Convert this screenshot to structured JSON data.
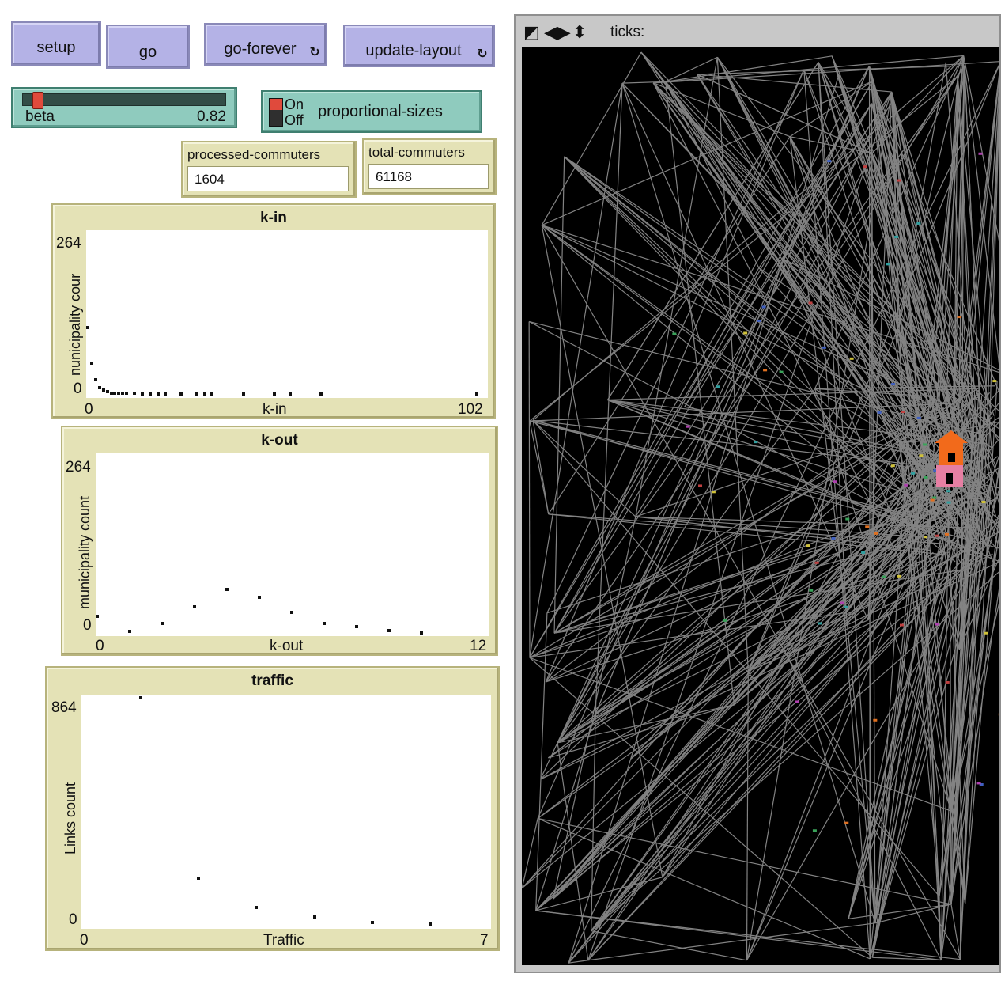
{
  "buttons": {
    "setup": "setup",
    "go": "go",
    "go_forever": "go-forever",
    "update_layout": "update-layout"
  },
  "slider": {
    "name": "beta",
    "value": "0.82",
    "level": 0.82
  },
  "switch": {
    "on_label": "On",
    "off_label": "Off",
    "name": "proportional-sizes",
    "state": "on"
  },
  "monitors": {
    "processed": {
      "label": "processed-commuters",
      "value": "1604"
    },
    "total": {
      "label": "total-commuters",
      "value": "61168"
    }
  },
  "plots": {
    "kin": {
      "title": "k-in",
      "ymax": "264",
      "ymin": "0",
      "xmin": "0",
      "xmax": "102",
      "xlabel": "k-in",
      "ylabel": "nunicipality cour"
    },
    "kout": {
      "title": "k-out",
      "ymax": "264",
      "ymin": "0",
      "xmin": "0",
      "xmax": "12",
      "xlabel": "k-out",
      "ylabel": "municipality count"
    },
    "traffic": {
      "title": "traffic",
      "ymax": "864",
      "ymin": "0",
      "xmin": "0",
      "xmax": "7",
      "xlabel": "Traffic",
      "ylabel": "Links count"
    }
  },
  "chart_data": [
    {
      "type": "scatter",
      "title": "k-in",
      "xlabel": "k-in",
      "ylabel": "nunicipality cour",
      "xlim": [
        0,
        102
      ],
      "ylim": [
        0,
        264
      ],
      "x": [
        0,
        1,
        2,
        3,
        4,
        5,
        6,
        7,
        8,
        9,
        10,
        12,
        14,
        16,
        18,
        20,
        24,
        28,
        30,
        32,
        40,
        48,
        52,
        60,
        100
      ],
      "y": [
        110,
        52,
        24,
        12,
        8,
        5,
        3,
        3,
        2,
        2,
        2,
        2,
        1,
        1,
        1,
        1,
        1,
        1,
        1,
        1,
        1,
        1,
        1,
        1,
        1
      ]
    },
    {
      "type": "scatter",
      "title": "k-out",
      "xlabel": "k-out",
      "ylabel": "municipality count",
      "xlim": [
        0,
        12
      ],
      "ylim": [
        0,
        264
      ],
      "x": [
        0,
        1,
        2,
        3,
        4,
        5,
        6,
        7,
        8,
        9,
        10
      ],
      "y": [
        25,
        2,
        14,
        39,
        65,
        53,
        31,
        14,
        10,
        4,
        0
      ]
    },
    {
      "type": "scatter",
      "title": "traffic",
      "xlabel": "Traffic",
      "ylabel": "Links count",
      "xlim": [
        0,
        7
      ],
      "ylim": [
        0,
        864
      ],
      "x": [
        1,
        2,
        3,
        4,
        5,
        6
      ],
      "y": [
        880,
        180,
        70,
        32,
        12,
        5
      ]
    }
  ],
  "view": {
    "ticks_label": "ticks:"
  },
  "colors": {
    "button": "#b4b2e6",
    "widget_green": "#8fcbbe",
    "monitor": "#e4e2b6",
    "link": "#9a9a9a",
    "house_top": "#f26a1b",
    "house_bottom": "#e67fa3"
  }
}
